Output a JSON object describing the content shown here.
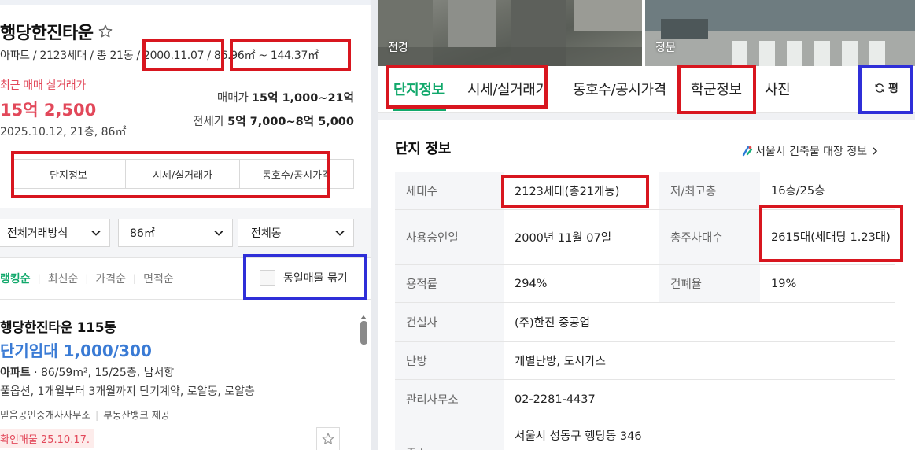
{
  "left": {
    "title": "행당한진타운",
    "meta": {
      "type_units": "아파트 / 2123세대 / 총 21동 / ",
      "approval_date": "2000.11.07",
      "slash": " / ",
      "area_range": "86.96㎡ ~ 144.37㎡"
    },
    "recent_label": "최근 매매 실거래가",
    "recent_price": "15억 2,500",
    "recent_detail": "2025.10.12, 21층, 86㎡",
    "sale": {
      "label": "매매가",
      "value": "15억 1,000~21억"
    },
    "jeonse": {
      "label": "전세가",
      "value": "5억 7,000~8억 5,000"
    },
    "sub_tabs": [
      "단지정보",
      "시세/실거래가",
      "동호수/공시가격"
    ],
    "filters": {
      "trade_type": "전체거래방식",
      "area": "86㎡",
      "building": "전체동"
    },
    "sort": {
      "items": [
        "랭킹순",
        "최신순",
        "가격순",
        "면적순"
      ],
      "active_index": 0
    },
    "group_same": "동일매물 묶기",
    "listing": {
      "title": "행당한진타운 115동",
      "price": "단기임대 1,000/300",
      "spec_type": "아파트",
      "spec_rest": " · 86/59m², 15/25층, 남서향",
      "desc": "풀옵션, 1개월부터 3개월까지 단기계약, 로얄동, 로얄층",
      "agent": "믿음공인중개사사무소",
      "provider": "부동산뱅크 제공",
      "confirm": "확인매물 25.10.17."
    }
  },
  "right": {
    "photos": [
      "전경",
      "정문"
    ],
    "tabs": [
      "단지정보",
      "시세/실거래가",
      "동호수/공시가격",
      "학군정보",
      "사진"
    ],
    "active_tab_index": 0,
    "unit_toggle": "평",
    "section_title": "단지 정보",
    "registry_link": "서울시 건축물 대장 정보",
    "rows": [
      {
        "l1": "세대수",
        "v1": "2123세대(총21개동)",
        "l2": "저/최고층",
        "v2": "16층/25층"
      },
      {
        "l1": "사용승인일",
        "v1": "2000년 11월 07일",
        "l2": "총주차대수",
        "v2": "2615대(세대당 1.23대)"
      },
      {
        "l1": "용적률",
        "v1": "294%",
        "l2": "건폐율",
        "v2": "19%"
      },
      {
        "l1": "건설사",
        "v1": "(주)한진 중공업"
      },
      {
        "l1": "난방",
        "v1": "개별난방, 도시가스"
      },
      {
        "l1": "관리사무소",
        "v1": "02-2281-4437"
      },
      {
        "l1": "주소",
        "v1": "서울시 성동구 행당동 346"
      }
    ]
  },
  "colors": {
    "accent_green": "#11a86b",
    "price_red": "#e2485a",
    "listing_blue": "#3a7bd5",
    "annotation_red": "#d8161f",
    "annotation_blue": "#2f2fd8"
  },
  "icons": [
    "star-icon",
    "chevron-down-icon",
    "refresh-icon",
    "building-registry-icon",
    "chevron-right-icon"
  ]
}
